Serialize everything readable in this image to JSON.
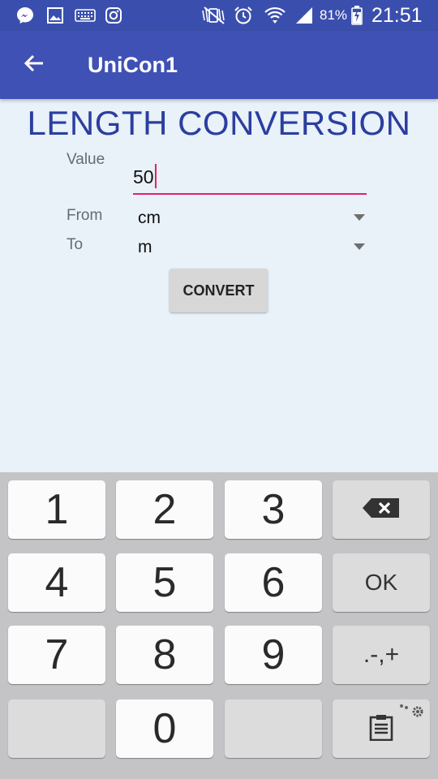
{
  "status_bar": {
    "battery_percent": "81%",
    "time": "21:51",
    "icons": [
      "messenger-icon",
      "gallery-icon",
      "keyboard-icon",
      "instagram-icon",
      "mute-icon",
      "alarm-icon",
      "wifi-icon",
      "signal-icon",
      "battery-charging-icon"
    ]
  },
  "app_bar": {
    "title": "UniCon1",
    "back_icon": "arrow-back-icon"
  },
  "main": {
    "heading": "LENGTH CONVERSION",
    "value_label": "Value",
    "value_input": "50",
    "from_label": "From",
    "from_value": "cm",
    "to_label": "To",
    "to_value": "m",
    "convert_button": "CONVERT"
  },
  "keyboard": {
    "keys": [
      "1",
      "2",
      "3",
      "4",
      "5",
      "6",
      "7",
      "8",
      "9",
      "0"
    ],
    "ok_label": "OK",
    "symbols_label": ".-,+",
    "backspace_icon": "backspace-icon",
    "clipboard_icon": "clipboard-icon",
    "settings_icon": "settings-gear-icon"
  },
  "colors": {
    "status_bar": "#3a4fad",
    "app_bar": "#3f51b5",
    "heading": "#2b3e9f",
    "accent": "#e91e63",
    "background": "#e9f1f9",
    "keyboard_bg": "#c4c4c6"
  }
}
